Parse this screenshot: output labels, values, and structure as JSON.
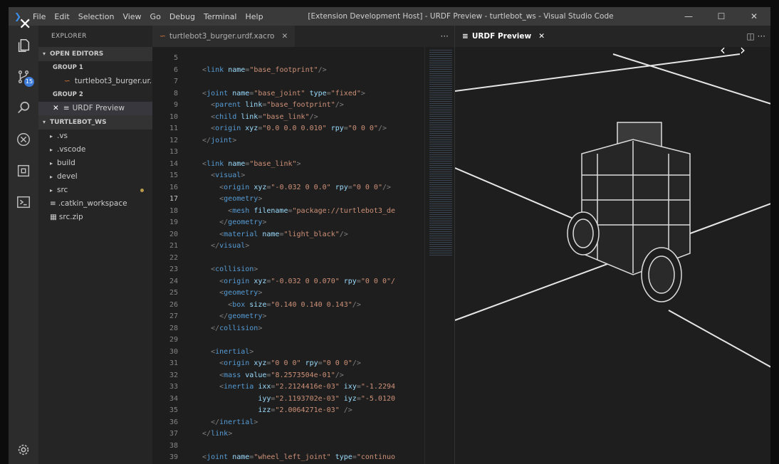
{
  "titlebar": {
    "menu": [
      "File",
      "Edit",
      "Selection",
      "View",
      "Go",
      "Debug",
      "Terminal",
      "Help"
    ],
    "title": "[Extension Development Host] - URDF Preview - turtlebot_ws - Visual Studio Code"
  },
  "activity": {
    "scm_badge": "15",
    "icons": [
      "explorer-icon",
      "source-control-icon",
      "search-icon",
      "debug-icon",
      "extensions-icon",
      "terminal-icon",
      "settings-gear-icon"
    ]
  },
  "sidebar": {
    "title": "EXPLORER",
    "open_editors_label": "OPEN EDITORS",
    "group1_label": "GROUP 1",
    "group1_file": "turtlebot3_burger.ur...",
    "group2_label": "GROUP 2",
    "group2_file": "URDF Preview",
    "workspace_label": "TURTLEBOT_WS",
    "tree": [
      {
        "name": ".vs",
        "type": "folder"
      },
      {
        "name": ".vscode",
        "type": "folder"
      },
      {
        "name": "build",
        "type": "folder"
      },
      {
        "name": "devel",
        "type": "folder"
      },
      {
        "name": "src",
        "type": "folder"
      },
      {
        "name": ".catkin_workspace",
        "type": "file"
      },
      {
        "name": "src.zip",
        "type": "file"
      }
    ]
  },
  "editor": {
    "tab_label": "turtlebot3_burger.urdf.xacro",
    "current_line": 17
  },
  "preview": {
    "tab_label": "URDF Preview"
  },
  "colors": {
    "accent": "#3d7bd8",
    "tag": "#569cd6",
    "attr": "#9cdcfe",
    "string": "#ce9178"
  },
  "code_lines": [
    {
      "n": "5",
      "segs": []
    },
    {
      "n": "6",
      "segs": [
        [
          "tk",
          "  <"
        ],
        [
          "tg",
          "link"
        ],
        [
          "tk",
          " "
        ],
        [
          "at",
          "name"
        ],
        [
          "tk",
          "="
        ],
        [
          "st",
          "\"base_footprint\""
        ],
        [
          "tk",
          "/>"
        ]
      ]
    },
    {
      "n": "7",
      "segs": []
    },
    {
      "n": "8",
      "segs": [
        [
          "tk",
          "  <"
        ],
        [
          "tg",
          "joint"
        ],
        [
          "tk",
          " "
        ],
        [
          "at",
          "name"
        ],
        [
          "tk",
          "="
        ],
        [
          "st",
          "\"base_joint\""
        ],
        [
          "tk",
          " "
        ],
        [
          "at",
          "type"
        ],
        [
          "tk",
          "="
        ],
        [
          "st",
          "\"fixed\""
        ],
        [
          "tk",
          ">"
        ]
      ]
    },
    {
      "n": "9",
      "segs": [
        [
          "tk",
          "    <"
        ],
        [
          "tg",
          "parent"
        ],
        [
          "tk",
          " "
        ],
        [
          "at",
          "link"
        ],
        [
          "tk",
          "="
        ],
        [
          "st",
          "\"base_footprint\""
        ],
        [
          "tk",
          "/>"
        ]
      ]
    },
    {
      "n": "10",
      "segs": [
        [
          "tk",
          "    <"
        ],
        [
          "tg",
          "child"
        ],
        [
          "tk",
          " "
        ],
        [
          "at",
          "link"
        ],
        [
          "tk",
          "="
        ],
        [
          "st",
          "\"base_link\""
        ],
        [
          "tk",
          "/>"
        ]
      ]
    },
    {
      "n": "11",
      "segs": [
        [
          "tk",
          "    <"
        ],
        [
          "tg",
          "origin"
        ],
        [
          "tk",
          " "
        ],
        [
          "at",
          "xyz"
        ],
        [
          "tk",
          "="
        ],
        [
          "st",
          "\"0.0 0.0 0.010\""
        ],
        [
          "tk",
          " "
        ],
        [
          "at",
          "rpy"
        ],
        [
          "tk",
          "="
        ],
        [
          "st",
          "\"0 0 0\""
        ],
        [
          "tk",
          "/>"
        ]
      ]
    },
    {
      "n": "12",
      "segs": [
        [
          "tk",
          "  </"
        ],
        [
          "tg",
          "joint"
        ],
        [
          "tk",
          ">"
        ]
      ]
    },
    {
      "n": "13",
      "segs": []
    },
    {
      "n": "14",
      "segs": [
        [
          "tk",
          "  <"
        ],
        [
          "tg",
          "link"
        ],
        [
          "tk",
          " "
        ],
        [
          "at",
          "name"
        ],
        [
          "tk",
          "="
        ],
        [
          "st",
          "\"base_link\""
        ],
        [
          "tk",
          ">"
        ]
      ]
    },
    {
      "n": "15",
      "segs": [
        [
          "tk",
          "    <"
        ],
        [
          "tg",
          "visual"
        ],
        [
          "tk",
          ">"
        ]
      ]
    },
    {
      "n": "16",
      "segs": [
        [
          "tk",
          "      <"
        ],
        [
          "tg",
          "origin"
        ],
        [
          "tk",
          " "
        ],
        [
          "at",
          "xyz"
        ],
        [
          "tk",
          "="
        ],
        [
          "st",
          "\"-0.032 0 0.0\""
        ],
        [
          "tk",
          " "
        ],
        [
          "at",
          "rpy"
        ],
        [
          "tk",
          "="
        ],
        [
          "st",
          "\"0 0 0\""
        ],
        [
          "tk",
          "/>"
        ]
      ]
    },
    {
      "n": "17",
      "segs": [
        [
          "tk",
          "      <"
        ],
        [
          "tg",
          "geometry"
        ],
        [
          "tk",
          ">"
        ]
      ]
    },
    {
      "n": "18",
      "segs": [
        [
          "tk",
          "        <"
        ],
        [
          "tg",
          "mesh"
        ],
        [
          "tk",
          " "
        ],
        [
          "at",
          "filename"
        ],
        [
          "tk",
          "="
        ],
        [
          "st",
          "\"package://turtlebot3_de"
        ]
      ]
    },
    {
      "n": "19",
      "segs": [
        [
          "tk",
          "      </"
        ],
        [
          "tg",
          "geometry"
        ],
        [
          "tk",
          ">"
        ]
      ]
    },
    {
      "n": "20",
      "segs": [
        [
          "tk",
          "      <"
        ],
        [
          "tg",
          "material"
        ],
        [
          "tk",
          " "
        ],
        [
          "at",
          "name"
        ],
        [
          "tk",
          "="
        ],
        [
          "st",
          "\"light_black\""
        ],
        [
          "tk",
          "/>"
        ]
      ]
    },
    {
      "n": "21",
      "segs": [
        [
          "tk",
          "    </"
        ],
        [
          "tg",
          "visual"
        ],
        [
          "tk",
          ">"
        ]
      ]
    },
    {
      "n": "22",
      "segs": []
    },
    {
      "n": "23",
      "segs": [
        [
          "tk",
          "    <"
        ],
        [
          "tg",
          "collision"
        ],
        [
          "tk",
          ">"
        ]
      ]
    },
    {
      "n": "24",
      "segs": [
        [
          "tk",
          "      <"
        ],
        [
          "tg",
          "origin"
        ],
        [
          "tk",
          " "
        ],
        [
          "at",
          "xyz"
        ],
        [
          "tk",
          "="
        ],
        [
          "st",
          "\"-0.032 0 0.070\""
        ],
        [
          "tk",
          " "
        ],
        [
          "at",
          "rpy"
        ],
        [
          "tk",
          "="
        ],
        [
          "st",
          "\"0 0 0\"/"
        ]
      ]
    },
    {
      "n": "25",
      "segs": [
        [
          "tk",
          "      <"
        ],
        [
          "tg",
          "geometry"
        ],
        [
          "tk",
          ">"
        ]
      ]
    },
    {
      "n": "26",
      "segs": [
        [
          "tk",
          "        <"
        ],
        [
          "tg",
          "box"
        ],
        [
          "tk",
          " "
        ],
        [
          "at",
          "size"
        ],
        [
          "tk",
          "="
        ],
        [
          "st",
          "\"0.140 0.140 0.143\""
        ],
        [
          "tk",
          "/>"
        ]
      ]
    },
    {
      "n": "27",
      "segs": [
        [
          "tk",
          "      </"
        ],
        [
          "tg",
          "geometry"
        ],
        [
          "tk",
          ">"
        ]
      ]
    },
    {
      "n": "28",
      "segs": [
        [
          "tk",
          "    </"
        ],
        [
          "tg",
          "collision"
        ],
        [
          "tk",
          ">"
        ]
      ]
    },
    {
      "n": "29",
      "segs": []
    },
    {
      "n": "30",
      "segs": [
        [
          "tk",
          "    <"
        ],
        [
          "tg",
          "inertial"
        ],
        [
          "tk",
          ">"
        ]
      ]
    },
    {
      "n": "31",
      "segs": [
        [
          "tk",
          "      <"
        ],
        [
          "tg",
          "origin"
        ],
        [
          "tk",
          " "
        ],
        [
          "at",
          "xyz"
        ],
        [
          "tk",
          "="
        ],
        [
          "st",
          "\"0 0 0\""
        ],
        [
          "tk",
          " "
        ],
        [
          "at",
          "rpy"
        ],
        [
          "tk",
          "="
        ],
        [
          "st",
          "\"0 0 0\""
        ],
        [
          "tk",
          "/>"
        ]
      ]
    },
    {
      "n": "32",
      "segs": [
        [
          "tk",
          "      <"
        ],
        [
          "tg",
          "mass"
        ],
        [
          "tk",
          " "
        ],
        [
          "at",
          "value"
        ],
        [
          "tk",
          "="
        ],
        [
          "st",
          "\"8.2573504e-01\""
        ],
        [
          "tk",
          "/>"
        ]
      ]
    },
    {
      "n": "33",
      "segs": [
        [
          "tk",
          "      <"
        ],
        [
          "tg",
          "inertia"
        ],
        [
          "tk",
          " "
        ],
        [
          "at",
          "ixx"
        ],
        [
          "tk",
          "="
        ],
        [
          "st",
          "\"2.2124416e-03\""
        ],
        [
          "tk",
          " "
        ],
        [
          "at",
          "ixy"
        ],
        [
          "tk",
          "="
        ],
        [
          "st",
          "\"-1.2294"
        ]
      ]
    },
    {
      "n": "34",
      "segs": [
        [
          "tk",
          "               "
        ],
        [
          "at",
          "iyy"
        ],
        [
          "tk",
          "="
        ],
        [
          "st",
          "\"2.1193702e-03\""
        ],
        [
          "tk",
          " "
        ],
        [
          "at",
          "iyz"
        ],
        [
          "tk",
          "="
        ],
        [
          "st",
          "\"-5.0120"
        ]
      ]
    },
    {
      "n": "35",
      "segs": [
        [
          "tk",
          "               "
        ],
        [
          "at",
          "izz"
        ],
        [
          "tk",
          "="
        ],
        [
          "st",
          "\"2.0064271e-03\""
        ],
        [
          "tk",
          " />"
        ]
      ]
    },
    {
      "n": "36",
      "segs": [
        [
          "tk",
          "    </"
        ],
        [
          "tg",
          "inertial"
        ],
        [
          "tk",
          ">"
        ]
      ]
    },
    {
      "n": "37",
      "segs": [
        [
          "tk",
          "  </"
        ],
        [
          "tg",
          "link"
        ],
        [
          "tk",
          ">"
        ]
      ]
    },
    {
      "n": "38",
      "segs": []
    },
    {
      "n": "39",
      "segs": [
        [
          "tk",
          "  <"
        ],
        [
          "tg",
          "joint"
        ],
        [
          "tk",
          " "
        ],
        [
          "at",
          "name"
        ],
        [
          "tk",
          "="
        ],
        [
          "st",
          "\"wheel_left_joint\""
        ],
        [
          "tk",
          " "
        ],
        [
          "at",
          "type"
        ],
        [
          "tk",
          "="
        ],
        [
          "st",
          "\"continuo"
        ]
      ]
    }
  ]
}
